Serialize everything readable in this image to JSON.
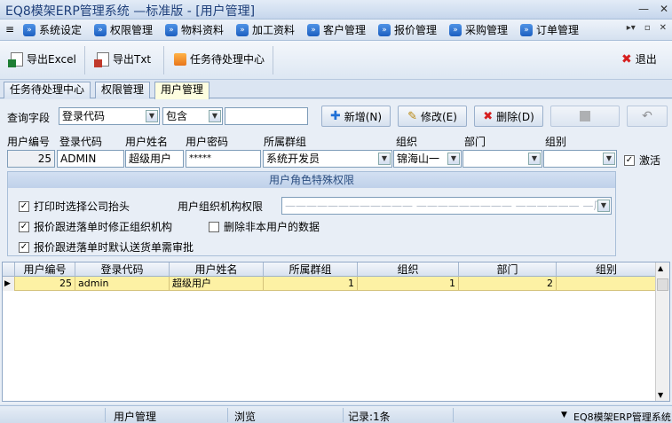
{
  "window": {
    "title": "EQ8模架ERP管理系统 —标准版 - [用户管理]"
  },
  "menu": {
    "items": [
      "系统设定",
      "权限管理",
      "物料资料",
      "加工资料",
      "客户管理",
      "报价管理",
      "采购管理",
      "订单管理"
    ]
  },
  "toolbar": {
    "export_excel": "导出Excel",
    "export_txt": "导出Txt",
    "task_center": "任务待处理中心",
    "exit": "退出"
  },
  "tabs": [
    "任务待处理中心",
    "权限管理",
    "用户管理"
  ],
  "query": {
    "label": "查询字段",
    "field": "登录代码",
    "op": "包含",
    "value": "",
    "add": "新增(N)",
    "edit": "修改(E)",
    "delete": "删除(D)"
  },
  "form": {
    "headers": [
      "用户编号",
      "登录代码",
      "用户姓名",
      "用户密码",
      "所属群组",
      "组织",
      "部门",
      "组别"
    ],
    "user_no": "25",
    "login_code": "ADMIN",
    "user_name": "超级用户",
    "password": "*****",
    "group": "系统开发员",
    "org": "锦海山一",
    "dept": "",
    "team": "",
    "active_label": "激活"
  },
  "permissions": {
    "title": "用户角色特殊权限",
    "print_company_header": "打印时选择公司抬头",
    "org_permission_label": "用户组织机构权限",
    "org_permission_value": "———————————— ————————— —————— —厂",
    "quote_modify_org": "报价跟进落单时修正组织机构",
    "delete_other_users": "删除非本用户的数据",
    "quote_default_review": "报价跟进落单时默认送货单需审批"
  },
  "grid": {
    "columns": [
      "用户编号",
      "登录代码",
      "用户姓名",
      "所属群组",
      "组织",
      "部门",
      "组别"
    ],
    "rows": [
      {
        "user_no": "25",
        "login_code": "admin",
        "user_name": "超级用户",
        "group": "1",
        "org": "1",
        "dept": "2",
        "team": ""
      }
    ]
  },
  "status": {
    "module": "用户管理",
    "mode": "浏览",
    "records": "记录:1条",
    "app": "EQ8模架ERP管理系统"
  }
}
